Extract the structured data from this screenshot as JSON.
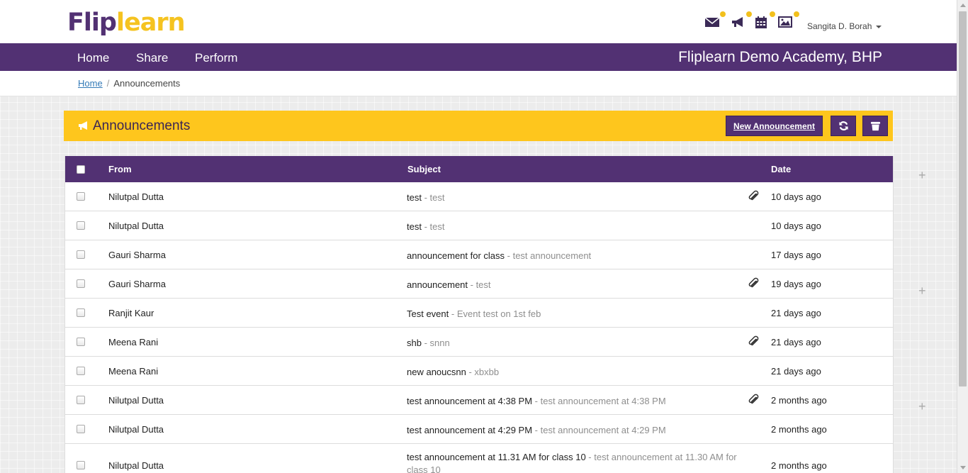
{
  "brand": {
    "logo_part1": "Flip",
    "logo_part2": "learn"
  },
  "header": {
    "user_name": "Sangita D. Borah",
    "icons": [
      "mail-icon",
      "megaphone-icon",
      "calendar-icon",
      "image-icon"
    ]
  },
  "nav": {
    "items": [
      "Home",
      "Share",
      "Perform"
    ],
    "academy": "Fliplearn Demo Academy, BHP"
  },
  "breadcrumb": {
    "home": "Home",
    "separator": "/",
    "current": "Announcements"
  },
  "panel": {
    "title": "Announcements",
    "new_button": "New Announcement",
    "refresh_icon": "refresh-icon",
    "delete_icon": "trash-icon"
  },
  "table": {
    "headers": {
      "from": "From",
      "subject": "Subject",
      "date": "Date"
    },
    "rows": [
      {
        "from": "Nilutpal Dutta",
        "subject": "test",
        "preview": " - test",
        "attachment": true,
        "date": "10 days ago"
      },
      {
        "from": "Nilutpal Dutta",
        "subject": "test",
        "preview": " - test",
        "attachment": false,
        "date": "10 days ago"
      },
      {
        "from": "Gauri Sharma",
        "subject": "announcement for class",
        "preview": " - test announcement",
        "attachment": false,
        "date": "17 days ago"
      },
      {
        "from": "Gauri Sharma",
        "subject": "announcement",
        "preview": " - test",
        "attachment": true,
        "date": "19 days ago"
      },
      {
        "from": "Ranjit Kaur",
        "subject": "Test event",
        "preview": " - Event test on 1st feb",
        "attachment": false,
        "date": "21 days ago"
      },
      {
        "from": "Meena Rani",
        "subject": "shb",
        "preview": " - snnn",
        "attachment": true,
        "date": "21 days ago"
      },
      {
        "from": "Meena Rani",
        "subject": "new anoucsnn",
        "preview": " - xbxbb",
        "attachment": false,
        "date": "21 days ago"
      },
      {
        "from": "Nilutpal Dutta",
        "subject": "test announcement at 4:38 PM",
        "preview": " - test announcement at 4:38 PM",
        "attachment": true,
        "date": "2 months ago"
      },
      {
        "from": "Nilutpal Dutta",
        "subject": "test announcement at 4:29 PM",
        "preview": " - test announcement at 4:29 PM",
        "attachment": false,
        "date": "2 months ago"
      },
      {
        "from": "Nilutpal Dutta",
        "subject": "test announcement at 11.31 AM for class 10",
        "preview": " - test announcement at 11.30 AM for class 10",
        "attachment": false,
        "date": "2 months ago"
      }
    ]
  },
  "colors": {
    "brand_purple": "#523173",
    "brand_yellow": "#fec61d"
  }
}
